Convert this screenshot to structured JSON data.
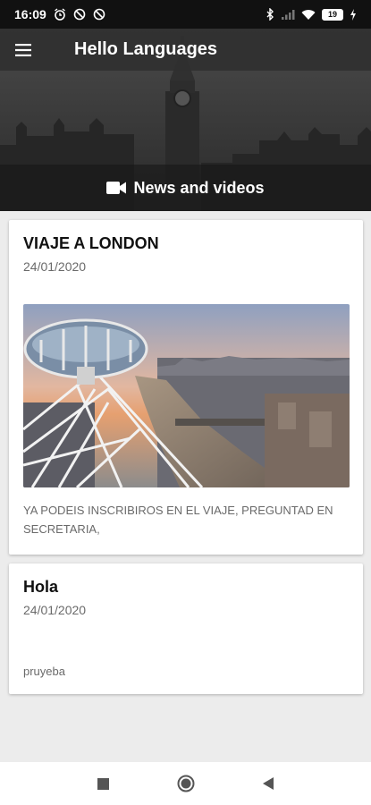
{
  "status": {
    "time": "16:09",
    "battery": "19",
    "icons": [
      "alarm-icon",
      "no-sync-icon",
      "no-sync-icon",
      "bluetooth-icon",
      "signal-icon",
      "wifi-icon",
      "battery-icon",
      "charging-icon"
    ]
  },
  "appbar": {
    "title": "Hello Languages",
    "menu_icon": "menu-icon"
  },
  "banner": {
    "section_label": "News and videos",
    "section_icon": "video-camera-icon"
  },
  "posts": [
    {
      "title": "VIAJE A LONDON",
      "date": "24/01/2020",
      "has_image": true,
      "body": "YA PODEIS INSCRIBIROS EN EL VIAJE, PREGUNTAD EN SECRETARIA,"
    },
    {
      "title": "Hola",
      "date": "24/01/2020",
      "has_image": false,
      "body": "pruyeba"
    }
  ],
  "navbar": {
    "icons": [
      "recents-square-icon",
      "home-circle-icon",
      "back-triangle-icon"
    ]
  },
  "colors": {
    "appbar": "#303030",
    "background": "#ececec",
    "card": "#ffffff",
    "date_text": "#6a6a6a"
  }
}
